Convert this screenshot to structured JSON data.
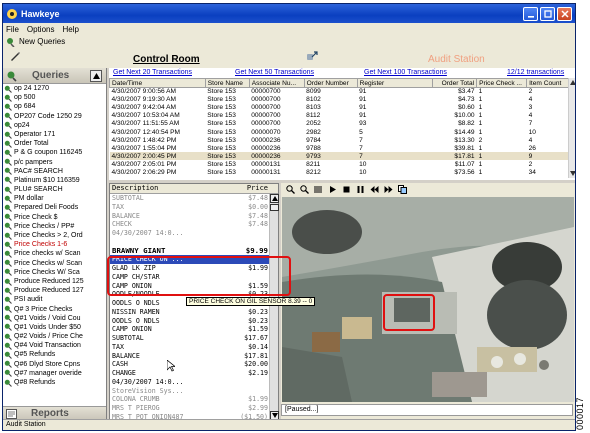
{
  "window": {
    "title": "Hawkeye"
  },
  "menu": [
    "File",
    "Options",
    "Help"
  ],
  "toolbar": {
    "new_queries": "New Queries"
  },
  "header": {
    "control_room": "Control Room",
    "audit_station": "Audit Station"
  },
  "queries": {
    "title": "Queries",
    "items": [
      {
        "label": "op 24 1270",
        "red": false
      },
      {
        "label": "op 500",
        "red": false
      },
      {
        "label": "op 684",
        "red": false
      },
      {
        "label": "OP207 Code 1250 29",
        "red": false
      },
      {
        "label": "op24",
        "red": false
      },
      {
        "label": "Operator 171",
        "red": false
      },
      {
        "label": "Order Total",
        "red": false
      },
      {
        "label": "P & G coupon 116245",
        "red": false
      },
      {
        "label": "p/c pampers",
        "red": false
      },
      {
        "label": "PAC# SEARCH",
        "red": false
      },
      {
        "label": "Platinum $10 116359",
        "red": false
      },
      {
        "label": "PLU# SEARCH",
        "red": false
      },
      {
        "label": "PM dollar",
        "red": false
      },
      {
        "label": "Prepared Deli Foods",
        "red": false
      },
      {
        "label": "Price Check $",
        "red": false
      },
      {
        "label": "Price Checks / PP#",
        "red": false
      },
      {
        "label": "Price Checks > 2, Ord",
        "red": false
      },
      {
        "label": "Price Checks 1-6",
        "red": true
      },
      {
        "label": "Price checks w/ Scan",
        "red": false
      },
      {
        "label": "Price Checks w/ Scan",
        "red": false
      },
      {
        "label": "Price Checks W/ Sca",
        "red": false
      },
      {
        "label": "Produce Reduced 125",
        "red": false
      },
      {
        "label": "Produce Reduced 127",
        "red": false
      },
      {
        "label": "PSI audit",
        "red": false
      },
      {
        "label": "Q# 3 Price Checks",
        "red": false
      },
      {
        "label": "Q#1 Voids / Void Cou",
        "red": false
      },
      {
        "label": "Q#1 Voids Under $50",
        "red": false
      },
      {
        "label": "Q#2 Voids / Price Che",
        "red": false
      },
      {
        "label": "Q#4 Void Transaction",
        "red": false
      },
      {
        "label": "Q#5 Refunds",
        "red": false
      },
      {
        "label": "Q#6 Dlyd Store Cpns",
        "red": false
      },
      {
        "label": "Q#7 manager overide",
        "red": false
      },
      {
        "label": "Q#8 Refunds",
        "red": false
      }
    ]
  },
  "reports": {
    "title": "Reports"
  },
  "transactions": {
    "links": {
      "next20": "Get Next 20 Transactions",
      "next50": "Get Next 50 Transactions",
      "next100": "Get Next 100 Transactions",
      "count": "12/12 transactions"
    },
    "columns": [
      "Date/Time",
      "Store Name",
      "Associate Nu...",
      "Order Number",
      "Register",
      "Order Total",
      "Price Check ...",
      "Item Count"
    ],
    "rows": [
      [
        "4/30/2007 9:00:56 AM",
        "Store 153",
        "00000700",
        "8099",
        "91",
        "$3.47",
        "1",
        "2"
      ],
      [
        "4/30/2007 9:19:30 AM",
        "Store 153",
        "00000700",
        "8102",
        "91",
        "$4.73",
        "1",
        "4"
      ],
      [
        "4/30/2007 9:42:04 AM",
        "Store 153",
        "00000700",
        "8103",
        "91",
        "$0.60",
        "1",
        "3"
      ],
      [
        "4/30/2007 10:53:04 AM",
        "Store 153",
        "00000700",
        "8112",
        "91",
        "$10.00",
        "1",
        "4"
      ],
      [
        "4/30/2007 11:51:55 AM",
        "Store 153",
        "00000700",
        "2052",
        "93",
        "$8.82",
        "1",
        "7"
      ],
      [
        "4/30/2007 12:40:54 PM",
        "Store 153",
        "00000070",
        "2982",
        "5",
        "$14.49",
        "1",
        "10"
      ],
      [
        "4/30/2007 1:48:42 PM",
        "Store 153",
        "00000236",
        "9784",
        "7",
        "$13.30",
        "2",
        "4"
      ],
      [
        "4/30/2007 1:55:04 PM",
        "Store 153",
        "00000236",
        "9788",
        "7",
        "$39.81",
        "1",
        "26"
      ],
      [
        "4/30/2007 2:00:45 PM",
        "Store 153",
        "00000236",
        "9793",
        "7",
        "$17.81",
        "1",
        "9"
      ],
      [
        "4/30/2007 2:05:01 PM",
        "Store 153",
        "00000131",
        "8211",
        "10",
        "$11.07",
        "1",
        "2"
      ],
      [
        "4/30/2007 2:06:29 PM",
        "Store 153",
        "00000131",
        "8212",
        "10",
        "$73.56",
        "1",
        "34"
      ]
    ],
    "selected_row": 8
  },
  "receipt": {
    "header_desc": "Description",
    "header_price": "Price",
    "lines": [
      {
        "d": "SUBTOTAL",
        "p": "$7.48",
        "cls": "dim"
      },
      {
        "d": "TAX",
        "p": "$0.00",
        "cls": "dim"
      },
      {
        "d": "BALANCE",
        "p": "$7.48",
        "cls": "dim"
      },
      {
        "d": "CHECK",
        "p": "$7.48",
        "cls": "dim"
      },
      {
        "d": "04/30/2007 14:0...",
        "p": "",
        "cls": "dim"
      },
      {
        "d": "",
        "p": "",
        "cls": "dim"
      },
      {
        "d": "BRAWNY GIANT",
        "p": "$9.99",
        "cls": "big"
      },
      {
        "d": "PRICE CHECK ON ...",
        "p": "",
        "cls": "hl"
      },
      {
        "d": "GLAD LK ZIP",
        "p": "$1.99",
        "cls": ""
      },
      {
        "d": "CAMP CH/STAR",
        "p": "",
        "cls": ""
      },
      {
        "d": "CAMP ONION",
        "p": "$1.59",
        "cls": ""
      },
      {
        "d": "OODLE/NOODLE",
        "p": "$0.23",
        "cls": ""
      },
      {
        "d": "OODLS O NDLS",
        "p": "$0.23",
        "cls": ""
      },
      {
        "d": "NISSIN RAMEN",
        "p": "$0.23",
        "cls": ""
      },
      {
        "d": "OODLS O NDLS",
        "p": "$0.23",
        "cls": ""
      },
      {
        "d": "CAMP ONION",
        "p": "$1.59",
        "cls": ""
      },
      {
        "d": "SUBTOTAL",
        "p": "$17.67",
        "cls": ""
      },
      {
        "d": "TAX",
        "p": "$0.14",
        "cls": ""
      },
      {
        "d": "BALANCE",
        "p": "$17.81",
        "cls": ""
      },
      {
        "d": "CASH",
        "p": "$20.00",
        "cls": ""
      },
      {
        "d": "CHANGE",
        "p": "$2.19",
        "cls": ""
      },
      {
        "d": "04/30/2007 14:0...",
        "p": "",
        "cls": ""
      },
      {
        "d": "StoreVision Sys...",
        "p": "",
        "cls": "dim"
      },
      {
        "d": "COLONA CRUMB",
        "p": "$1.99",
        "cls": "dim"
      },
      {
        "d": "MRS T PIEROG",
        "p": "$2.99",
        "cls": "dim"
      },
      {
        "d": "MRS T POT ONION487",
        "p": "($1.50)",
        "cls": "dim"
      }
    ],
    "tooltip": "PRICE CHECK ON GIL SENSOR  8.39 -- 0"
  },
  "video": {
    "status": "[Paused...]"
  },
  "status_bar": "Audit Station",
  "side_code": "000017",
  "colors": {
    "title_blue": "#0a3fc0",
    "highlight_red": "#e01010",
    "selection_blue": "#2c4ab8",
    "link_blue": "#0000cc"
  }
}
